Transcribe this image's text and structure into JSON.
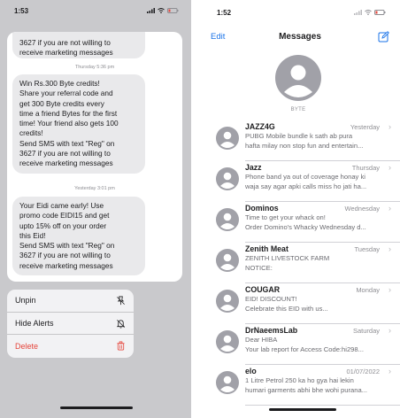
{
  "left": {
    "status_time": "1:53",
    "bubbles": [
      {
        "lines": [
          "3627 if you are not willing to",
          "receive marketing messages"
        ]
      },
      {
        "lines": [
          "Win Rs.300 Byte credits!",
          "Share your referral code and",
          "get 300 Byte credits every",
          "time a friend Bytes for the first",
          "time! Your friend also gets 100",
          "credits!",
          "Send SMS with text \"Reg\" on",
          "3627 if you are not willing to",
          "receive marketing messages"
        ]
      },
      {
        "lines": [
          "Your Eidi came early! Use",
          "promo code EIDI15 and get",
          "upto 15% off on your order",
          "this Eid!",
          "Send SMS with text \"Reg\" on",
          "3627 if you are not willing to",
          "receive marketing messages"
        ]
      }
    ],
    "stamps": [
      "Thursday 5:36 pm",
      "Yesterday 3:01 pm"
    ],
    "menu": {
      "unpin": "Unpin",
      "hide_alerts": "Hide Alerts",
      "delete": "Delete",
      "delete_color": "#e5453b"
    }
  },
  "right": {
    "status_time": "1:52",
    "nav": {
      "edit": "Edit",
      "title": "Messages",
      "accent": "#1a73e8"
    },
    "pinned": {
      "name": "BYTE"
    },
    "conversations": [
      {
        "name": "JAZZ4G",
        "date": "Yesterday",
        "line1": "PUBG Mobile bundle k sath ab pura",
        "line2": "hafta milay non stop fun and entertain..."
      },
      {
        "name": "Jazz",
        "date": "Thursday",
        "line1": "Phone band ya out of coverage honay ki",
        "line2": "waja say agar apki calls miss ho jati ha..."
      },
      {
        "name": "Dominos",
        "date": "Wednesday",
        "line1": "Time to get your whack on!",
        "line2": "Order Domino's Whacky Wednesday d..."
      },
      {
        "name": "Zenith Meat",
        "date": "Tuesday",
        "line1": "ZENITH LIVESTOCK FARM",
        "line2": "NOTICE:"
      },
      {
        "name": "COUGAR",
        "date": "Monday",
        "line1": "EID! DISCOUNT!",
        "line2": "Celebrate this EID with us..."
      },
      {
        "name": "DrNaeemsLab",
        "date": "Saturday",
        "line1": "Dear HIBA",
        "line2": "Your lab report for Access Code:hi298..."
      },
      {
        "name": "elo",
        "date": "01/07/2022",
        "line1": "1 Litre Petrol 250 ka ho gya hai lekin",
        "line2": "humari garments abhi bhe wohi purana..."
      }
    ]
  }
}
